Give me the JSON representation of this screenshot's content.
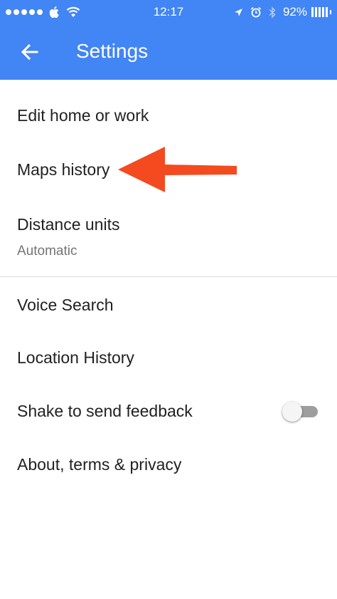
{
  "status_bar": {
    "carrier_icon": "apple-icon",
    "time": "12:17",
    "battery_percent": "92%"
  },
  "app_bar": {
    "title": "Settings",
    "back_icon": "arrow-left-icon",
    "color": "#4285f4"
  },
  "settings": {
    "edit_home_work": "Edit home or work",
    "maps_history": "Maps history",
    "distance_units": {
      "label": "Distance units",
      "value": "Automatic"
    },
    "voice_search": "Voice Search",
    "location_history": "Location History",
    "shake_feedback": {
      "label": "Shake to send feedback",
      "enabled": false
    },
    "about": "About, terms & privacy"
  },
  "annotation": {
    "arrow_color": "#f44a1f",
    "points_to": "Maps history"
  }
}
